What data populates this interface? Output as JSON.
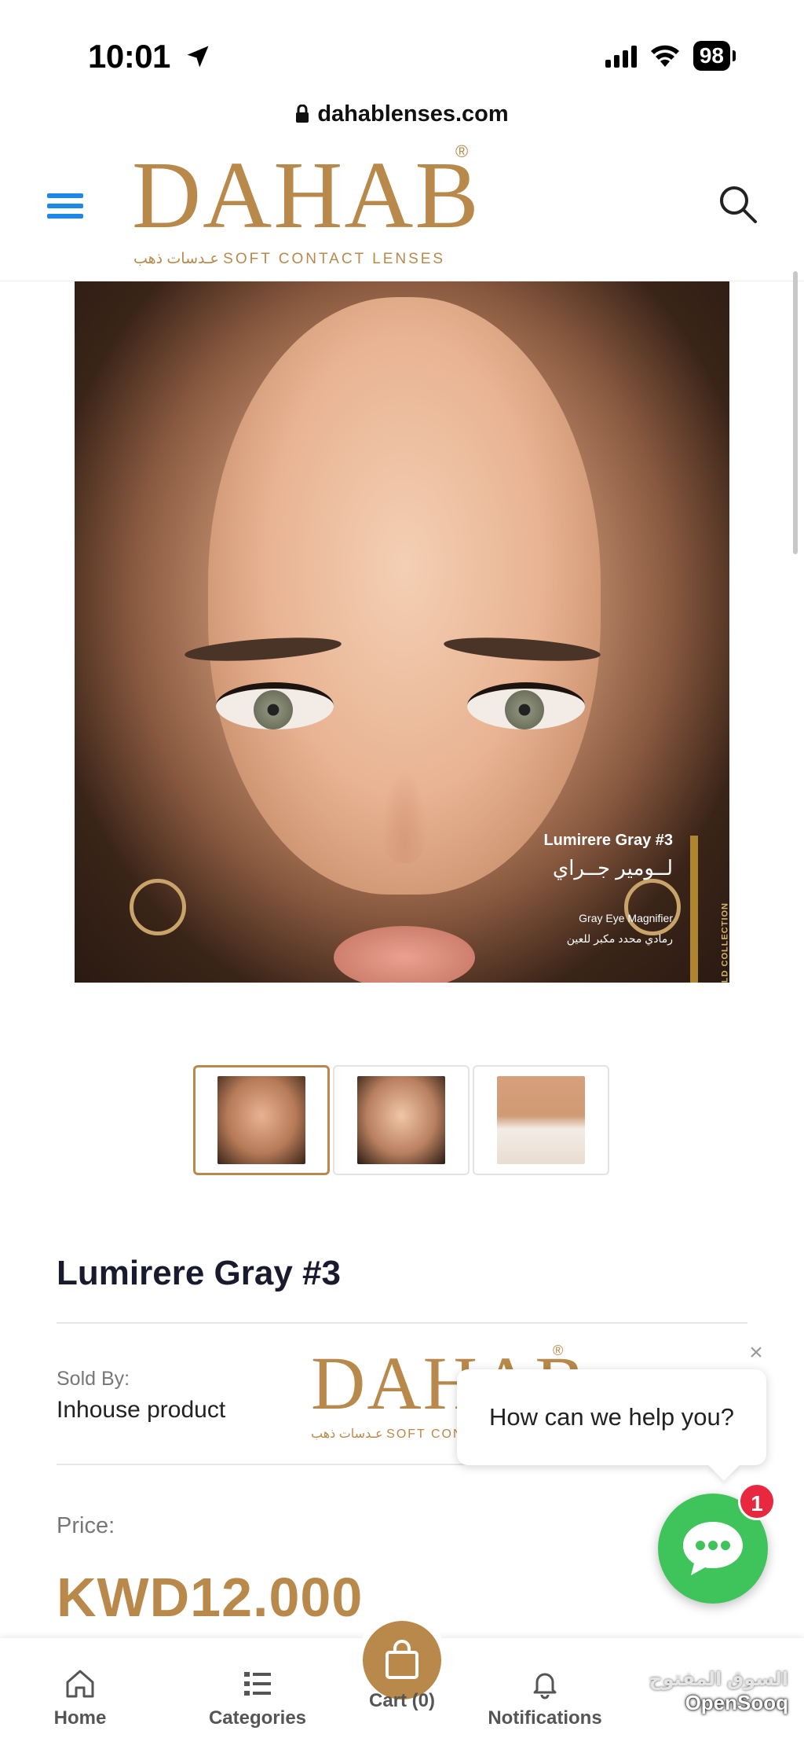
{
  "status_bar": {
    "time": "10:01",
    "battery": "98"
  },
  "url_bar": {
    "domain": "dahablenses.com"
  },
  "header": {
    "logo_text": "DAHAB",
    "logo_registered": "®",
    "logo_tagline": "عـدسات ذهب  SOFT CONTACT LENSES"
  },
  "product_image": {
    "caption_title": "Lumirere Gray #3",
    "caption_arabic": "لــومير جــراي",
    "caption_sub": "Gray Eye Magnifier",
    "caption_arabic_sub": "رمادي محدد مكبر للعين",
    "collection_label": "GOLD COLLECTION"
  },
  "product": {
    "title": "Lumirere Gray #3",
    "sold_by_label": "Sold By:",
    "sold_by_value": "Inhouse product",
    "seller_logo": "DAHAB",
    "seller_logo_registered": "®",
    "seller_tagline": "عـدسات ذهب  SOFT CONTACT LENSES",
    "price_label": "Price:",
    "price_value": "KWD12.000"
  },
  "chat": {
    "close": "×",
    "prompt": "How can we help you?",
    "badge_count": "1"
  },
  "bottom_nav": {
    "items": [
      {
        "label": "Home",
        "icon": "home-icon"
      },
      {
        "label": "Categories",
        "icon": "list-icon"
      },
      {
        "label": "Cart (0)",
        "icon": "shopping-bag-icon"
      },
      {
        "label": "Notifications",
        "icon": "bell-icon"
      }
    ]
  },
  "watermark": {
    "arabic": "السوق المفتوح",
    "english": "OpenSooq"
  },
  "colors": {
    "brand_gold": "#b8894a",
    "menu_blue": "#1e88e5",
    "chat_green": "#3fc45c",
    "badge_red": "#e8283f"
  }
}
